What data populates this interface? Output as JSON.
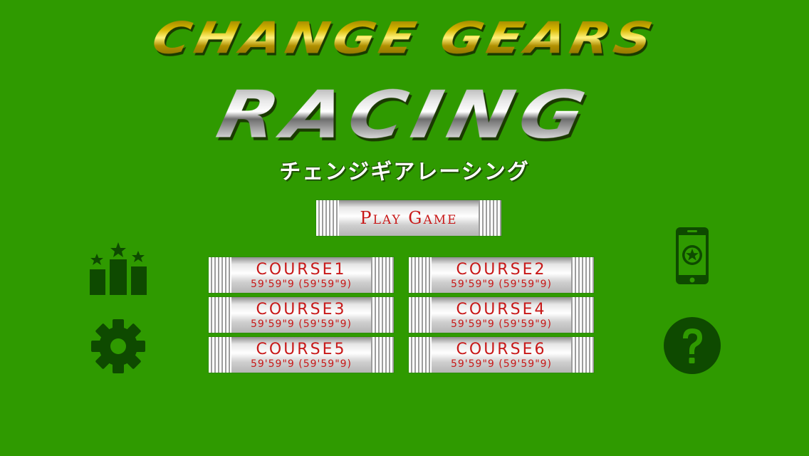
{
  "title": {
    "line1": "CHANGE GEARS",
    "line2": "RACING",
    "japanese": "チェンジギアレーシング"
  },
  "menu": {
    "play_label": "Play Game"
  },
  "courses": [
    {
      "name": "COURSE1",
      "time": "59'59\"9 (59'59\"9)"
    },
    {
      "name": "COURSE2",
      "time": "59'59\"9 (59'59\"9)"
    },
    {
      "name": "COURSE3",
      "time": "59'59\"9 (59'59\"9)"
    },
    {
      "name": "COURSE4",
      "time": "59'59\"9 (59'59\"9)"
    },
    {
      "name": "COURSE5",
      "time": "59'59\"9 (59'59\"9)"
    },
    {
      "name": "COURSE6",
      "time": "59'59\"9 (59'59\"9)"
    }
  ],
  "icons": {
    "leaderboard": "ranking-podium-icon",
    "settings": "gear-icon",
    "device": "phone-star-icon",
    "help": "question-mark-icon"
  },
  "colors": {
    "background": "#2f9a00",
    "icon": "#0e4a00",
    "label_red": "#c81818"
  }
}
